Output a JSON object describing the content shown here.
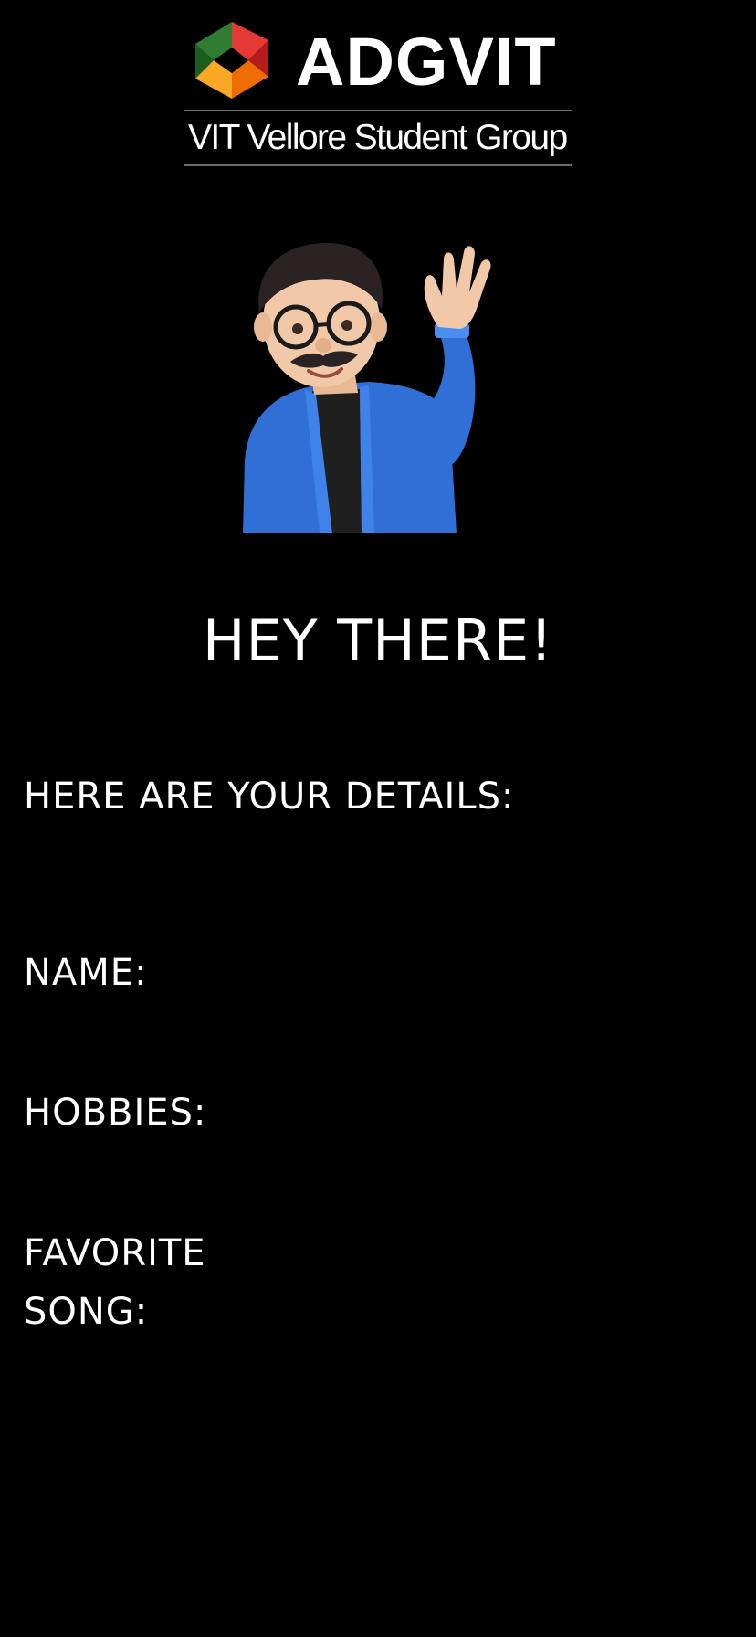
{
  "header": {
    "brand_name": "ADGVIT",
    "subtitle": "VIT Vellore Student Group",
    "logo_colors": [
      "#e53935",
      "#2e7d32",
      "#f9a825",
      "#ef6c00"
    ]
  },
  "avatar": {
    "icon": "waving-memoji-icon",
    "colors": {
      "jacket": "#2f6fd6",
      "skin": "#f2c9a8",
      "hair": "#2b2224"
    }
  },
  "main": {
    "greeting": "HEY THERE!",
    "details_heading": "HERE ARE YOUR DETAILS:",
    "fields": {
      "name_label": "NAME:",
      "hobbies_label": "HOBBIES:",
      "song_label": "FAVORITE\n SONG:"
    }
  },
  "theme": {
    "background": "#000000",
    "text": "#ffffff"
  }
}
